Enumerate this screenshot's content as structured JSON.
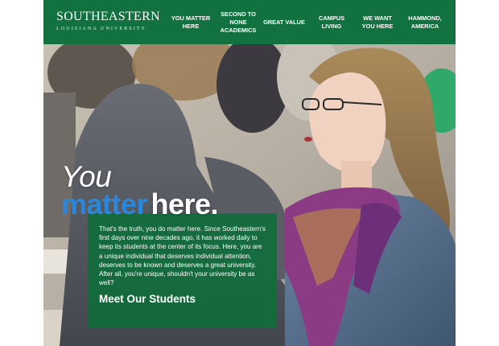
{
  "header": {
    "logo_main": "SOUTHEASTERN",
    "logo_sub": "LOUISIANA UNIVERSITY",
    "nav": [
      {
        "label": "YOU MATTER HERE"
      },
      {
        "label": "SECOND TO NONE ACADEMICS"
      },
      {
        "label": "GREAT VALUE"
      },
      {
        "label": "CAMPUS LIVING"
      },
      {
        "label": "WE WANT YOU HERE"
      },
      {
        "label": "HAMMOND, AMERICA"
      }
    ]
  },
  "hero": {
    "headline_you": "You",
    "headline_matter": "matter",
    "headline_here": "here.",
    "body": "That's the truth, you do matter here. Since Southeastern's first days over nine decades ago, it has worked daily to keep its students at the center of its focus. Here, you are a unique individual that deserves individual attention, deserves to be known and deserves a great university. After all, you're unique, shouldn't your university be as well?",
    "cta": "Meet Our Students"
  },
  "colors": {
    "brand_green": "#11713f",
    "accent_blue": "#2a87d9",
    "panel_green": "#106c3c"
  }
}
